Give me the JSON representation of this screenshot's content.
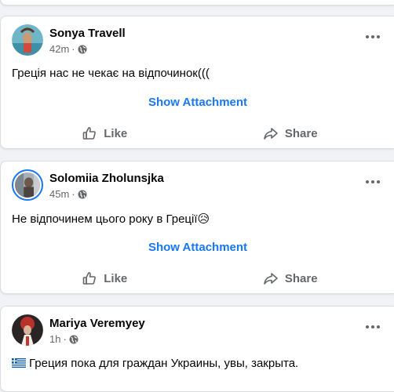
{
  "colors": {
    "accent": "#1877f2",
    "secondary_text": "#65676b",
    "background": "#f0f2f5"
  },
  "posts": [
    {
      "author": "Sonya Travell",
      "time": "42m",
      "separator": "·",
      "text": "Греція нас не чекає на відпочинок(((",
      "attachment_label": "Show Attachment",
      "like_label": "Like",
      "share_label": "Share"
    },
    {
      "author": "Solomiia Zholunsjka",
      "time": "45m",
      "separator": "·",
      "text": "Не відпочинем цього року в Греції😥",
      "attachment_label": "Show Attachment",
      "like_label": "Like",
      "share_label": "Share"
    },
    {
      "author": "Mariya Veremyey",
      "time": "1h",
      "separator": "·",
      "text": "Греция пока для граждан Украины, увы, закрыта."
    }
  ]
}
